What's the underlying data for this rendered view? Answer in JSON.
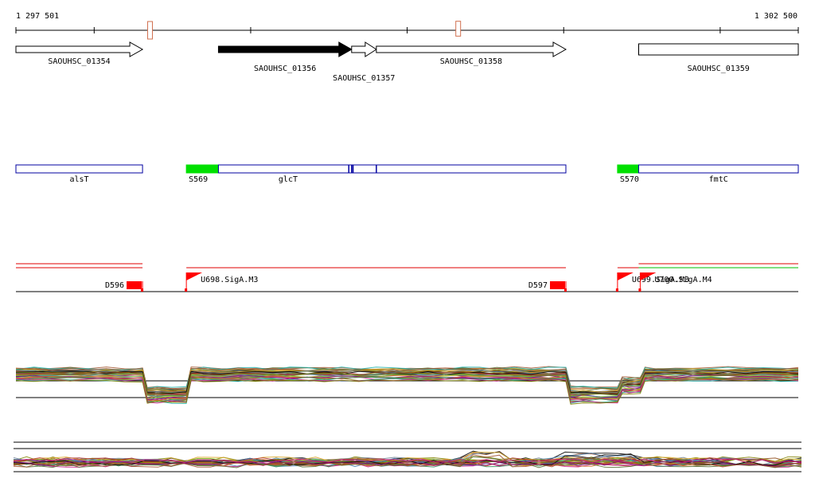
{
  "ruler": {
    "start_label": "1 297 501",
    "end_label": "1 302 500",
    "start": 1297501,
    "end": 1302500,
    "major_tick_step": 1000,
    "markers": [
      {
        "name": "marker-1",
        "pos": 1298358,
        "height_frac": 1.0,
        "color": "#d1704f"
      },
      {
        "name": "marker-2",
        "pos": 1300327,
        "height_frac": 0.85,
        "color": "#d1704f"
      }
    ]
  },
  "genes": [
    {
      "id": "SAOUHSC_01354",
      "label": "SAOUHSC_01354",
      "start": 1297501,
      "end": 1298310,
      "strand": "+",
      "filled": false,
      "row": 0
    },
    {
      "id": "SAOUHSC_01356",
      "label": "SAOUHSC_01356",
      "start": 1298795,
      "end": 1299646,
      "strand": "+",
      "filled": true,
      "row": 1
    },
    {
      "id": "SAOUHSC_01357",
      "label": "SAOUHSC_01357",
      "start": 1299646,
      "end": 1299804,
      "strand": "+",
      "filled": false,
      "row": 2
    },
    {
      "id": "SAOUHSC_01358",
      "label": "SAOUHSC_01358",
      "start": 1299804,
      "end": 1301015,
      "strand": "+",
      "filled": false,
      "row": 0
    },
    {
      "id": "SAOUHSC_01359",
      "label": "SAOUHSC_01359",
      "start": 1301480,
      "end": 1302500,
      "strand": "-",
      "filled": false,
      "row": 1
    }
  ],
  "annotations": [
    {
      "id": "alsT",
      "label": "alsT",
      "type": "gene",
      "start": 1297501,
      "end": 1298310
    },
    {
      "id": "S569",
      "label": "S569",
      "type": "segment",
      "start": 1298590,
      "end": 1298795
    },
    {
      "id": "glcT",
      "label": "glcT",
      "type": "gene",
      "start": 1298795,
      "end": 1301015,
      "dividers": [
        1299628,
        1299646,
        1299655,
        1299804
      ]
    },
    {
      "id": "S570",
      "label": "S570",
      "type": "segment",
      "start": 1301345,
      "end": 1301490
    },
    {
      "id": "fmtC",
      "label": "fmtC",
      "type": "gene",
      "start": 1301480,
      "end": 1302500
    }
  ],
  "regulatory": {
    "red_lines": [
      {
        "start": 1297501,
        "end": 1298310,
        "level": 0
      },
      {
        "start": 1297501,
        "end": 1298310,
        "level": 1
      },
      {
        "start": 1298590,
        "end": 1301015,
        "level": 1
      },
      {
        "start": 1301345,
        "end": 1301490,
        "level": 1
      },
      {
        "start": 1301480,
        "end": 1302500,
        "level": 0
      }
    ],
    "green_lines": [
      {
        "start": 1301480,
        "end": 1302500,
        "level": 1
      }
    ],
    "features": [
      {
        "id": "D596",
        "label": "D596",
        "type": "terminator",
        "pos": 1298310
      },
      {
        "id": "U698.SigA.M3",
        "label": "U698.SigA.M3",
        "type": "promoter",
        "pos": 1298590
      },
      {
        "id": "D597",
        "label": "D597",
        "type": "terminator",
        "pos": 1301015
      },
      {
        "id": "U699.SigA.M3",
        "label": "U699.SigA.M3",
        "type": "promoter",
        "pos": 1301345
      },
      {
        "id": "U700.SigA.M4",
        "label": "U700.SigA.M4",
        "type": "promoter",
        "pos": 1301490
      }
    ]
  },
  "expression": {
    "colors": [
      "#8b4513",
      "#6b8e23",
      "#b03030",
      "#4682b4",
      "#9acd32",
      "#800080",
      "#d2691e",
      "#2e8b57",
      "#c71585",
      "#808000",
      "#20b2aa",
      "#a0522d",
      "#556b2f",
      "#daa520",
      "#708090",
      "#000000"
    ],
    "segments": [
      {
        "start": 1297501,
        "end": 1298310,
        "level": "high"
      },
      {
        "start": 1298310,
        "end": 1298590,
        "level": "low"
      },
      {
        "start": 1298590,
        "end": 1301015,
        "level": "high"
      },
      {
        "start": 1301015,
        "end": 1301345,
        "level": "low"
      },
      {
        "start": 1301345,
        "end": 1301490,
        "level": "mid"
      },
      {
        "start": 1301490,
        "end": 1302500,
        "level": "high"
      }
    ]
  }
}
